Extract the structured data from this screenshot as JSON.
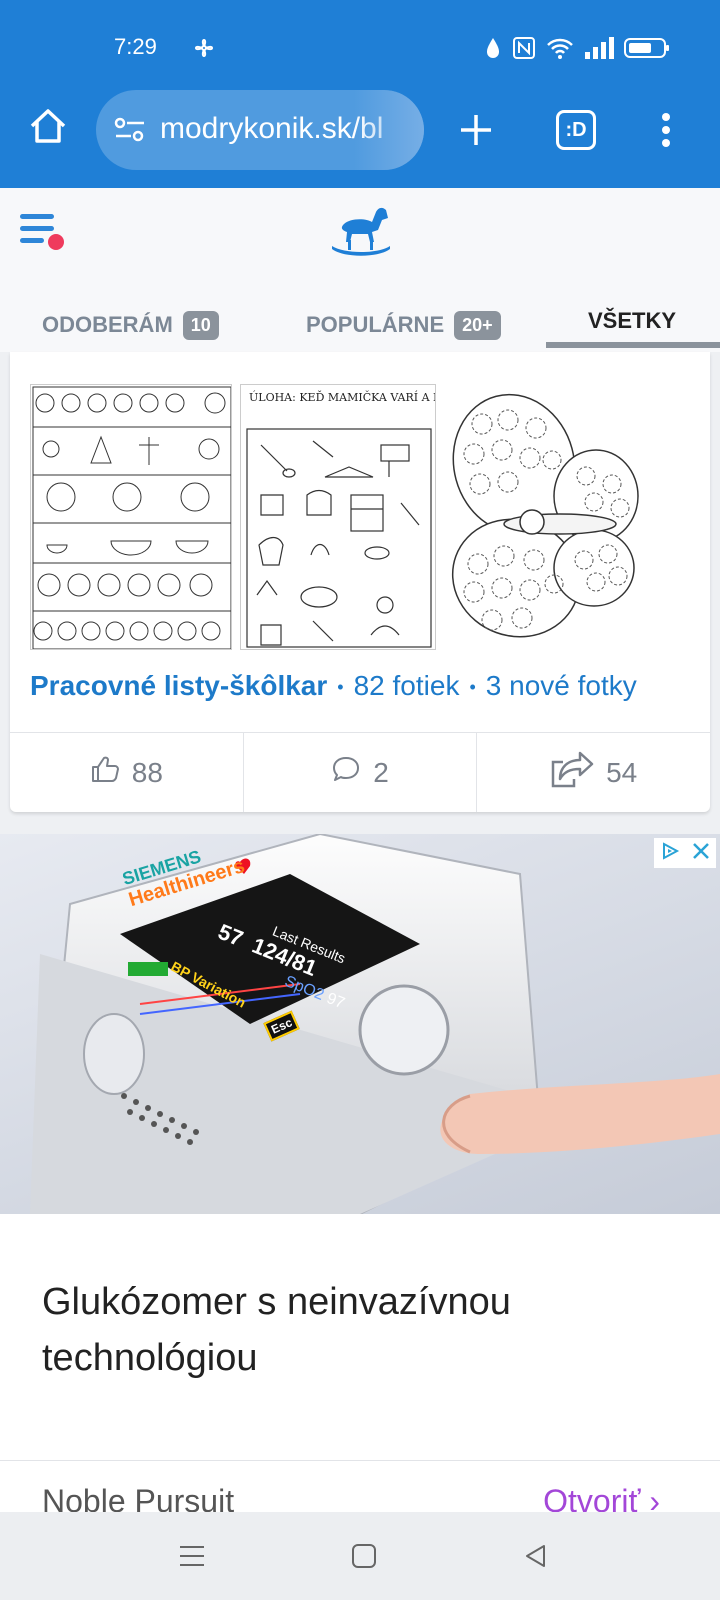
{
  "status_bar": {
    "time": "7:29"
  },
  "browser": {
    "url": "modrykonik.sk/bl",
    "tab_switcher_label": ":D"
  },
  "tabs": [
    {
      "label": "ODOBERÁM",
      "count": "10"
    },
    {
      "label": "POPULÁRNE",
      "count": "20+"
    },
    {
      "label": "VŠETKY"
    }
  ],
  "album": {
    "title": "Pracovné listy-škôlkar",
    "photos": "82 fotiek",
    "new_photos": "3 nové fotky",
    "thumbnails": [
      {
        "heading": ""
      },
      {
        "heading": "ÚLOHA: KEĎ MAMIČKA VARÍ A PEČIE"
      },
      {
        "heading": ""
      }
    ],
    "likes": "88",
    "comments": "2",
    "shares": "54"
  },
  "ad": {
    "title": "Glukózomer s neinvazívnou technológiou",
    "brand": "Noble Pursuit",
    "cta": "Otvoriť",
    "device_brand": "SIEMENS",
    "device_sub": "Healthineers",
    "screen_title": "Last Results",
    "bp_reading": "124/81",
    "pulse": "57",
    "spo2_label": "SpO2",
    "spo2_value": "97",
    "bp_variation": "BP Variation",
    "esc_label": "Esc"
  },
  "colors": {
    "chrome": "#1f7fd6",
    "link": "#1d7ac9",
    "cta": "#a347d8",
    "menu_dot": "#ef3b5d"
  }
}
